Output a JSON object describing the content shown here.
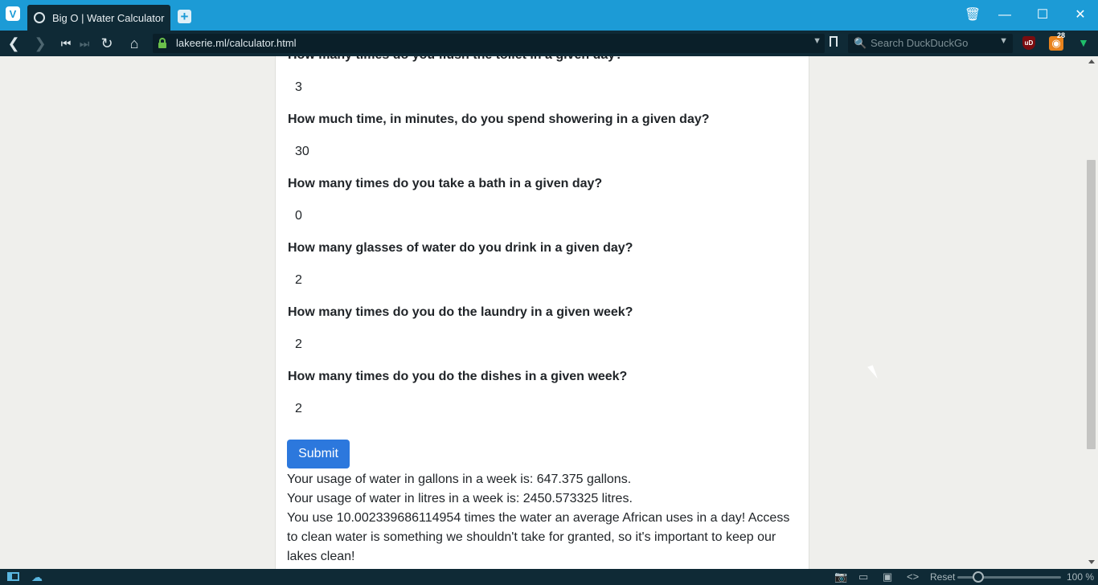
{
  "browser": {
    "logo_letter": "V",
    "tab_title": "Big O | Water Calculator",
    "new_tab": "+",
    "url": "lakeerie.ml/calculator.html",
    "search_placeholder": "Search DuckDuckGo",
    "rss_count": "28",
    "ublock_label": "uD",
    "accent_color": "#1c9bd6"
  },
  "form": {
    "questions": [
      {
        "label": "How many times do you flush the toilet in a given day?",
        "answer": "3"
      },
      {
        "label": "How much time, in minutes, do you spend showering in a given day?",
        "answer": "30"
      },
      {
        "label": "How many times do you take a bath in a given day?",
        "answer": "0"
      },
      {
        "label": "How many glasses of water do you drink in a given day?",
        "answer": "2"
      },
      {
        "label": "How many times do you do the laundry in a given week?",
        "answer": "2"
      },
      {
        "label": "How many times do you do the dishes in a given week?",
        "answer": "2"
      }
    ],
    "submit_label": "Submit",
    "submit_color": "#2c78dd"
  },
  "results": {
    "gallons": "Your usage of water in gallons in a week is: 647.375 gallons.",
    "litres": "Your usage of water in litres in a week is: 2450.573325 litres.",
    "comparison": "You use 10.002339686114954 times the water an average African uses in a day! Access to clean water is something we shouldn't take for granted, so it's important to keep our lakes clean!"
  },
  "statusbar": {
    "reset_label": "Reset",
    "zoom_level": "100 %"
  }
}
